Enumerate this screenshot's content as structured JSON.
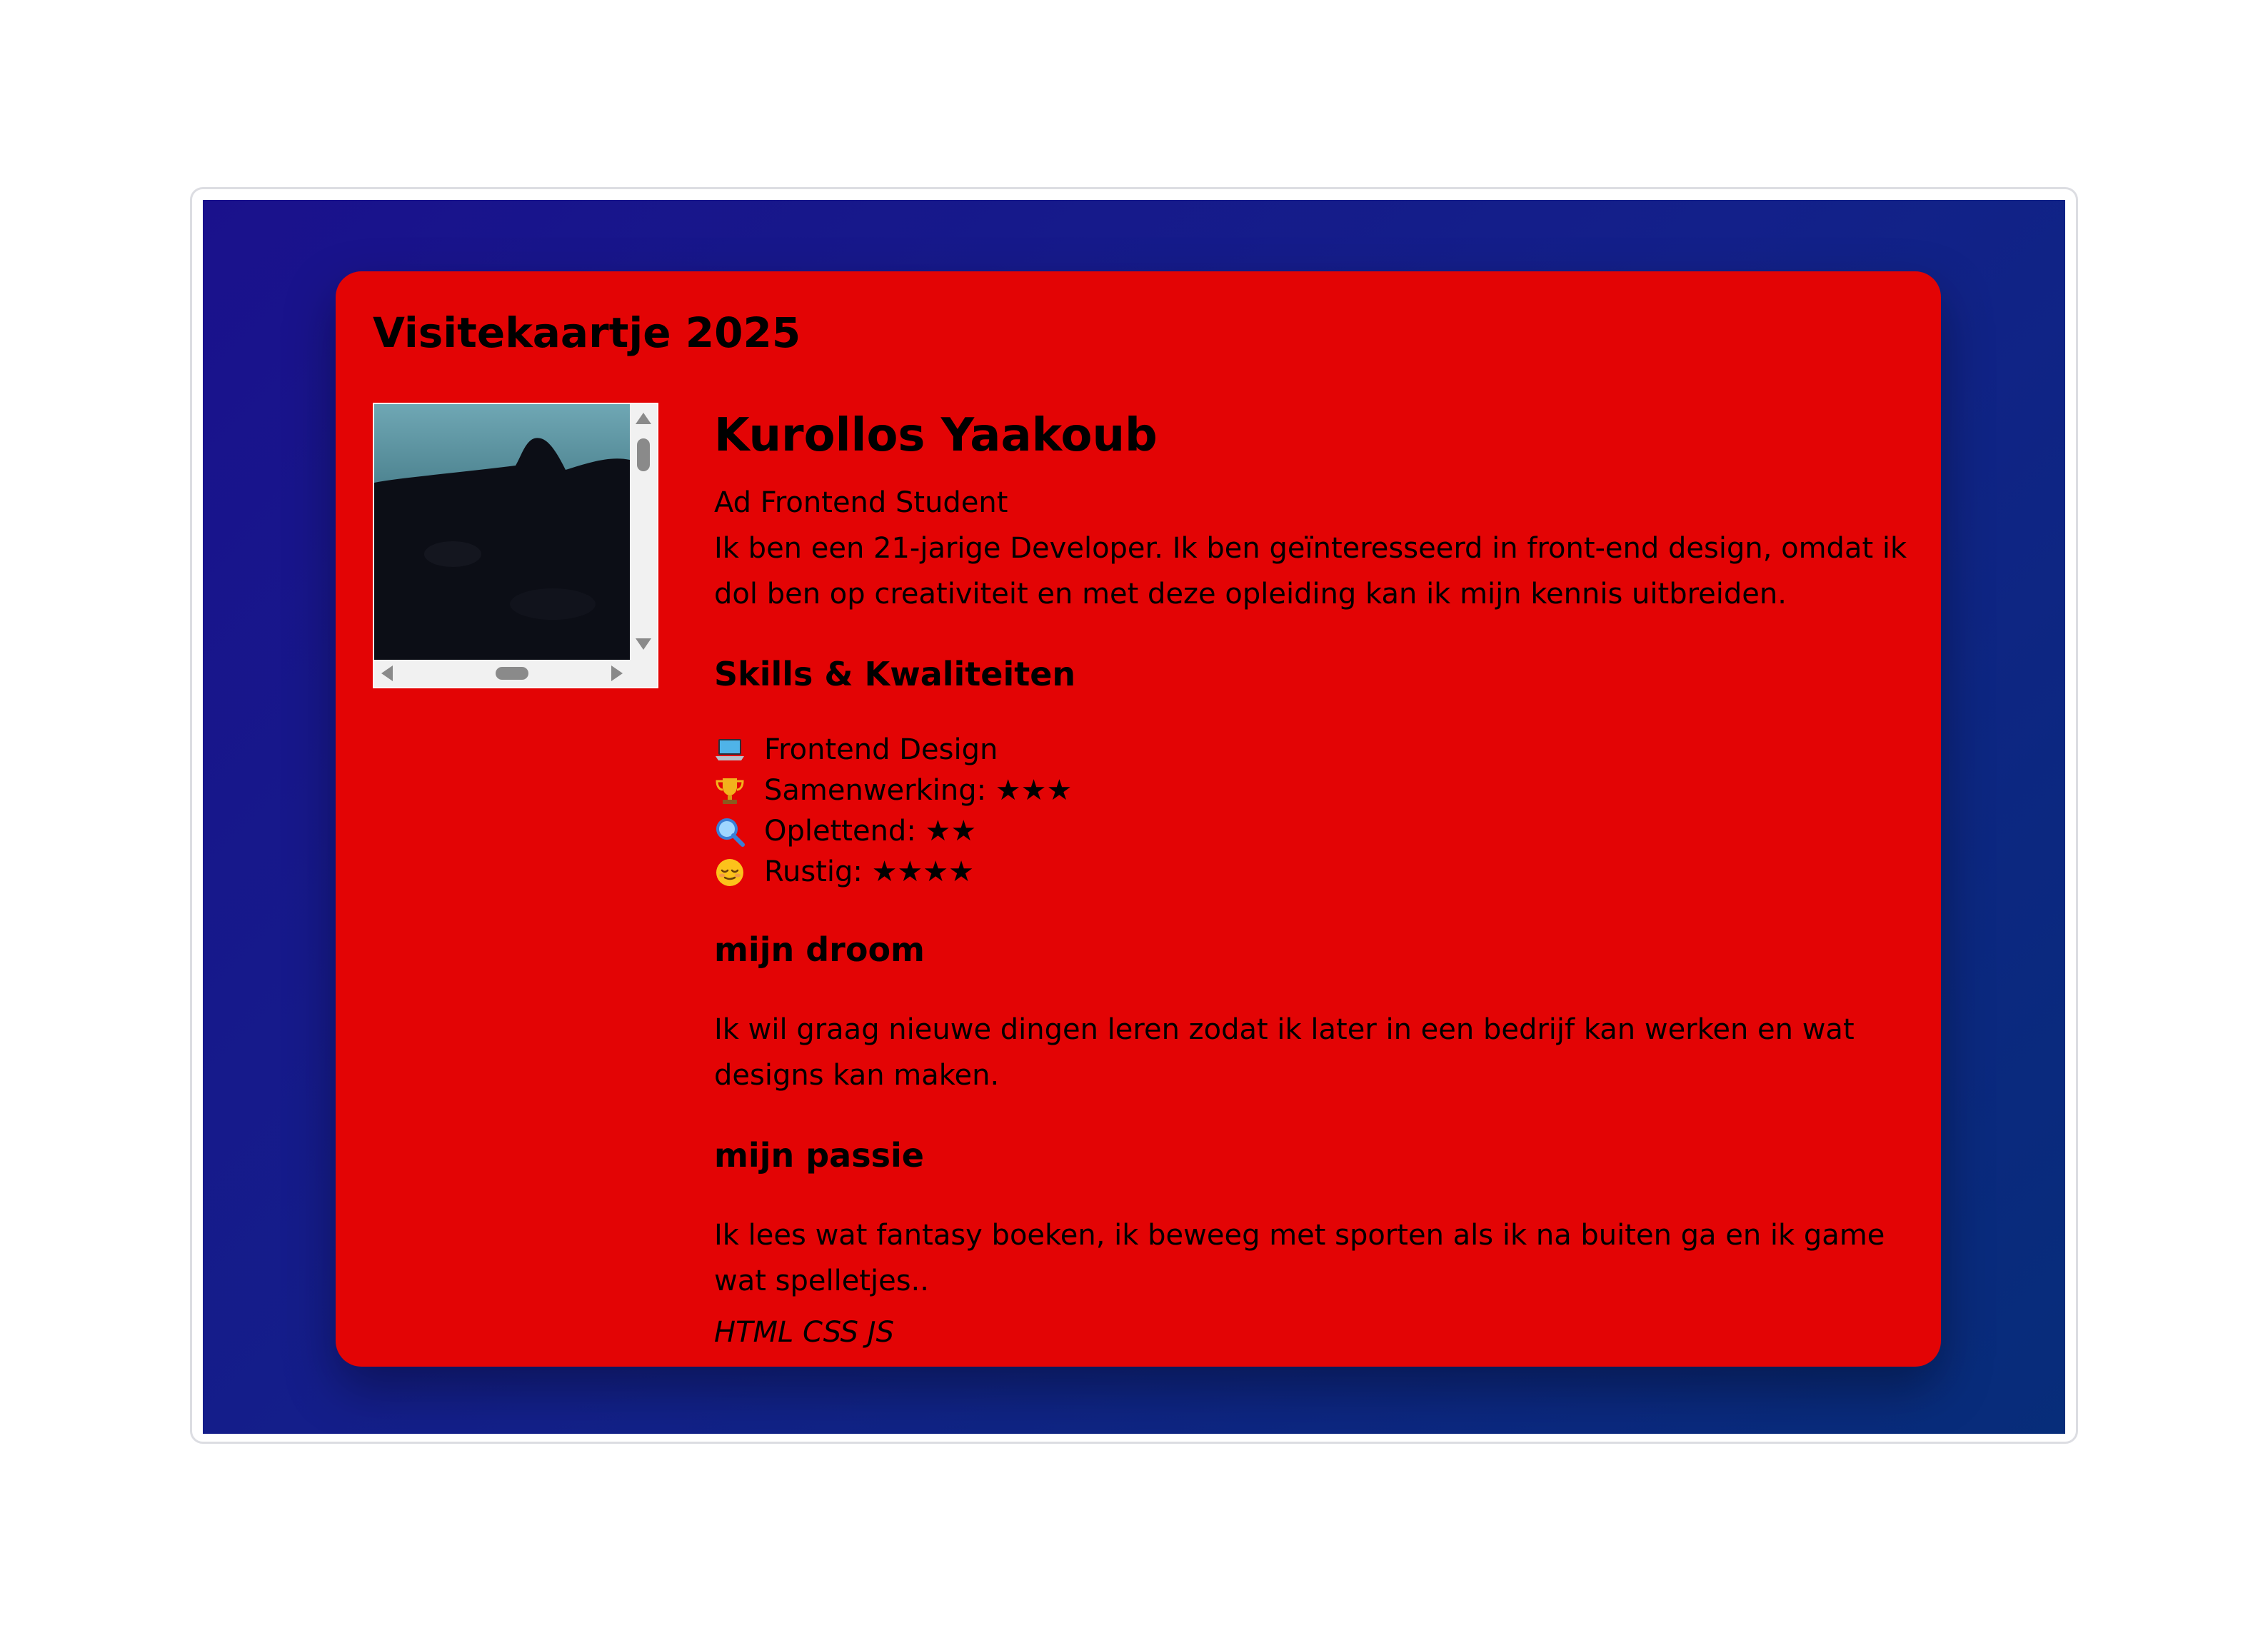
{
  "card": {
    "title": "Visitekaartje 2025"
  },
  "profile": {
    "name": "Kurollos Yaakoub",
    "role": "Ad Frontend Student",
    "intro": "Ik ben een 21-jarige Developer. Ik ben geïnteresseerd in front-end design, omdat ik dol ben op creativiteit en met deze opleiding kan ik mijn kennis uitbreiden."
  },
  "skills": {
    "heading": "Skills & Kwaliteiten",
    "items": [
      {
        "icon": "laptop-icon",
        "label": "Frontend Design"
      },
      {
        "icon": "trophy-icon",
        "label": "Samenwerking: ★★★"
      },
      {
        "icon": "magnifier-icon",
        "label": "Oplettend: ★★"
      },
      {
        "icon": "relieved-face-icon",
        "label": "Rustig: ★★★★"
      }
    ]
  },
  "dream": {
    "heading": "mijn droom",
    "text": "Ik wil graag nieuwe dingen leren zodat ik later in een bedrijf kan werken en wat designs kan maken."
  },
  "passion": {
    "heading": "mijn passie",
    "text": "Ik lees wat fantasy boeken, ik beweeg met sporten als ik na buiten ga en ik game wat spelletjes.."
  },
  "tech": "HTML CSS JS",
  "colors": {
    "card_background": "#e30405",
    "page_gradient_start": "#1a118c",
    "page_gradient_end": "#072d7a"
  }
}
